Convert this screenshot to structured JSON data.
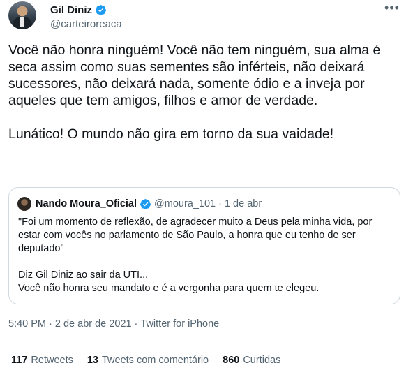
{
  "author": {
    "display_name": "Gil Diniz",
    "handle": "@carteiroreaca"
  },
  "tweet": {
    "text": "Você não honra ninguém! Você não tem ninguém, sua alma é seca assim como suas sementes são inférteis, não deixará sucessores, não deixará nada, somente ódio e a inveja por aqueles que tem amigos, filhos e amor de verdade.\n\nLunático! O mundo não gira em torno da sua vaidade!"
  },
  "quote": {
    "display_name": "Nando Moura_Oficial",
    "handle": "@moura_101",
    "separator": "·",
    "date": "1 de abr",
    "text": "\"Foi um momento de reflexão, de agradecer muito a Deus pela minha vida, por estar com vocês no parlamento de São Paulo, a honra que eu tenho de ser deputado\"\n\nDiz Gil Diniz ao sair da UTI...\nVocê não honra seu mandato e é a vergonha para quem te elegeu."
  },
  "meta": {
    "timestamp": "5:40 PM · 2 de abr de 2021",
    "separator": "·",
    "source": "Twitter for iPhone"
  },
  "stats": {
    "retweets_count": "117",
    "retweets_label": "Retweets",
    "quotes_count": "13",
    "quotes_label": "Tweets com comentário",
    "likes_count": "860",
    "likes_label": "Curtidas"
  },
  "icons": {
    "verified": "verified-badge-icon",
    "more": "more-horizontal-icon"
  },
  "colors": {
    "verified_blue": "#1d9bf0",
    "secondary_text": "#536471",
    "border": "#cfd9de"
  }
}
